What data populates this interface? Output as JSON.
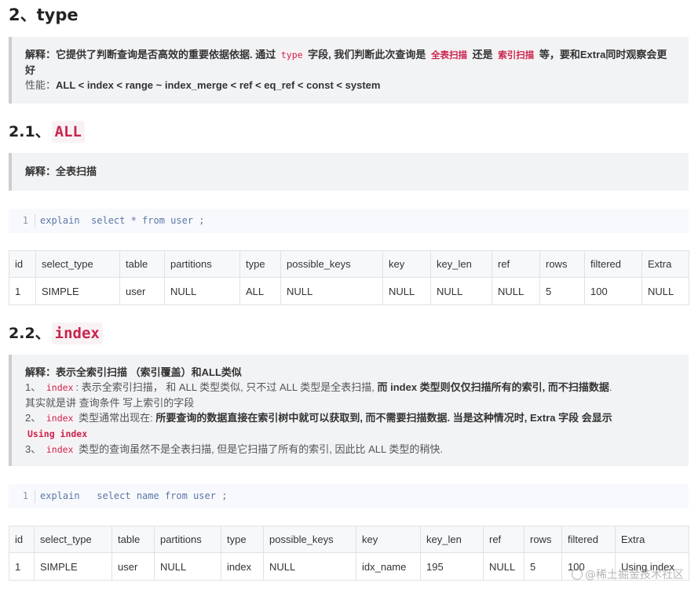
{
  "section": {
    "title": "2、type"
  },
  "intro_quote": {
    "label": "解释：",
    "p1": "它提供了判断查询是否高效的重要依据依据. 通过 ",
    "code_type": "type",
    "p2": " 字段, 我们判断此次查询是 ",
    "code_full": "全表扫描",
    "p3": " 还是 ",
    "code_index": "索引扫描",
    "p4": " 等，要和Extra同时观察会更好",
    "perf_label": "性能：",
    "perf_value": "ALL < index < range ~ index_merge < ref < eq_ref < const < system"
  },
  "all_section": {
    "number": "2.1、",
    "code": "ALL",
    "quote_label": "解释：",
    "quote_text": "全表扫描",
    "code_line_no": "1",
    "code_text": "explain  select * from user ;",
    "table": {
      "headers": [
        "id",
        "select_type",
        "table",
        "partitions",
        "type",
        "possible_keys",
        "key",
        "key_len",
        "ref",
        "rows",
        "filtered",
        "Extra"
      ],
      "rows": [
        [
          "1",
          "SIMPLE",
          "user",
          "NULL",
          "ALL",
          "NULL",
          "NULL",
          "NULL",
          "NULL",
          "5",
          "100",
          "NULL"
        ]
      ]
    }
  },
  "index_section": {
    "number": "2.2、",
    "code": "index",
    "quote_title": "解释：表示全索引扫描 （索引覆盖）和ALL类似",
    "item1_no": "1、 ",
    "item1_code": "index",
    "item1_text_a": ": 表示全索引扫描， 和 ALL 类型类似, 只不过 ALL 类型是全表扫描, ",
    "item1_bold": "而 index 类型则仅仅扫描所有的索引, 而不扫描数据",
    "item1_text_b": ".",
    "item1_line2": "其实就是讲 查询条件 写上索引的字段",
    "item2_no": "2、 ",
    "item2_code": "index",
    "item2_text_a": " 类型通常出现在: ",
    "item2_bold": "所要查询的数据直接在索引树中就可以获取到, 而不需要扫描数据. 当是这种情况时, Extra 字段 会显示",
    "item2_code2": "Using index",
    "item3_no": "3、 ",
    "item3_code": "index",
    "item3_text": " 类型的查询虽然不是全表扫描, 但是它扫描了所有的索引, 因此比 ALL 类型的稍快.",
    "code_line_no": "1",
    "code_text": "explain   select name from user ;",
    "table": {
      "headers": [
        "id",
        "select_type",
        "table",
        "partitions",
        "type",
        "possible_keys",
        "key",
        "key_len",
        "ref",
        "rows",
        "filtered",
        "Extra"
      ],
      "rows": [
        [
          "1",
          "SIMPLE",
          "user",
          "NULL",
          "index",
          "NULL",
          "idx_name",
          "195",
          "NULL",
          "5",
          "100",
          "Using index"
        ]
      ]
    }
  },
  "watermark": "@稀土掘金技术社区"
}
